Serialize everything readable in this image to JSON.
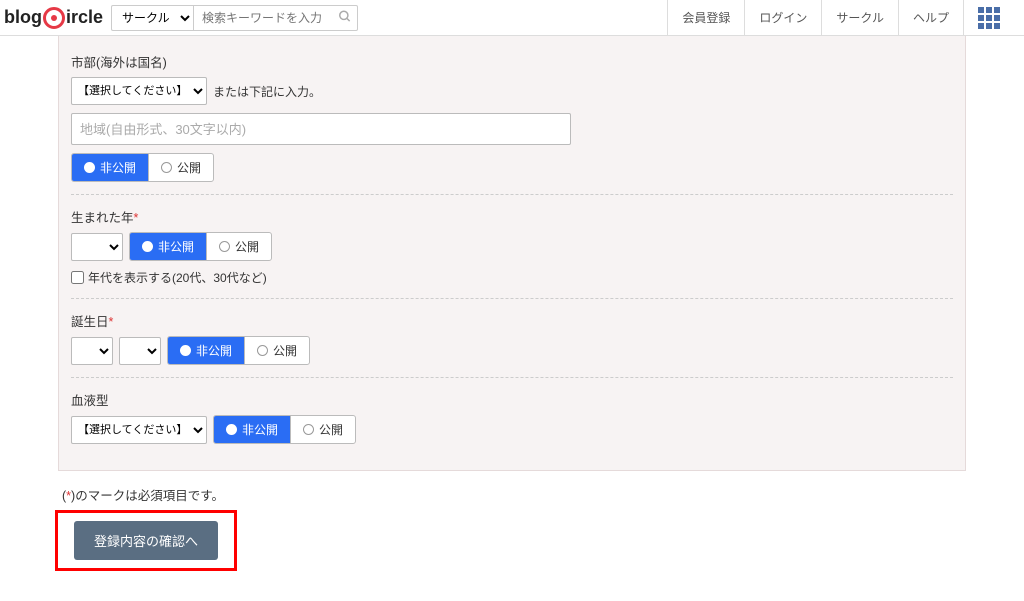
{
  "header": {
    "logo_main": "blog",
    "logo_tail": "ircle",
    "category_options": [
      "サークル"
    ],
    "search_placeholder": "検索キーワードを入力",
    "nav": [
      "会員登録",
      "ログイン",
      "サークル",
      "ヘルプ"
    ]
  },
  "form": {
    "city": {
      "label": "市部(海外は国名)",
      "select_placeholder": "【選択してください】",
      "or_text": "または下記に入力。",
      "free_placeholder": "地域(自由形式、30文字以内)"
    },
    "birth_year": {
      "label": "生まれた年",
      "checkbox_label": "年代を表示する(20代、30代など)"
    },
    "birthday": {
      "label": "誕生日"
    },
    "blood": {
      "label": "血液型",
      "select_placeholder": "【選択してください】"
    },
    "privacy": {
      "private": "非公開",
      "public": "公開"
    },
    "footnote_pre": "(",
    "footnote_mark": "*",
    "footnote_post": ")のマークは必須項目です。",
    "submit": "登録内容の確認へ"
  }
}
